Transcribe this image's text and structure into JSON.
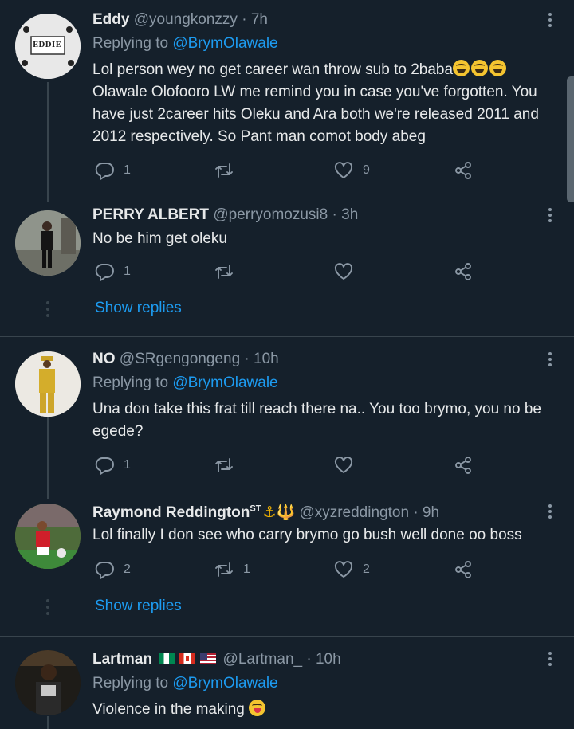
{
  "tweets": [
    {
      "name": "Eddy",
      "handle": "@youngkonzzy",
      "time": "· 7h",
      "replying_label": "Replying to",
      "replying_to": "@BrymOlawale",
      "avatar_text": "EDDIE",
      "body_1": "Lol person wey no get career wan throw sub to 2baba",
      "body_2": "Olawale Olofooro LW me remind you in case you've forgotten. You have just 2career hits Oleku and Ara both we're released 2011 and 2012 respectively. So Pant man comot body abeg",
      "replies": "1",
      "retweets": "",
      "likes": "9"
    },
    {
      "name": "PERRY ALBERT",
      "handle": "@perryomozusi8",
      "time": "· 3h",
      "body": "No be him get oleku",
      "replies": "1",
      "retweets": "",
      "likes": "",
      "show_replies": "Show replies"
    },
    {
      "name": "NO",
      "handle": "@SRgengongeng",
      "time": "· 10h",
      "replying_label": "Replying to",
      "replying_to": "@BrymOlawale",
      "body": "Una don take this frat till reach there na.. You too brymo, you no be egede?",
      "replies": "1",
      "retweets": "",
      "likes": ""
    },
    {
      "name": "Raymond Reddington",
      "name_suffix": "ST",
      "name_symbols": "⚓🔱",
      "handle": "@xyzreddington",
      "time": "· 9h",
      "body": "Lol finally I don see who carry brymo go bush well done oo boss",
      "replies": "2",
      "retweets": "1",
      "likes": "2",
      "show_replies": "Show replies"
    },
    {
      "name": "Lartman",
      "handle": "@Lartman_",
      "time": "· 10h",
      "replying_label": "Replying to",
      "replying_to": "@BrymOlawale",
      "body": "Violence in the making"
    }
  ],
  "icons": {
    "reply": "reply-icon",
    "retweet": "retweet-icon",
    "like": "heart-icon",
    "share": "share-icon",
    "more": "more-icon"
  },
  "colors": {
    "background": "#15202b",
    "text": "#e7e9ea",
    "secondary": "#8b98a5",
    "accent": "#1d9bf0",
    "divider": "#38444d"
  }
}
